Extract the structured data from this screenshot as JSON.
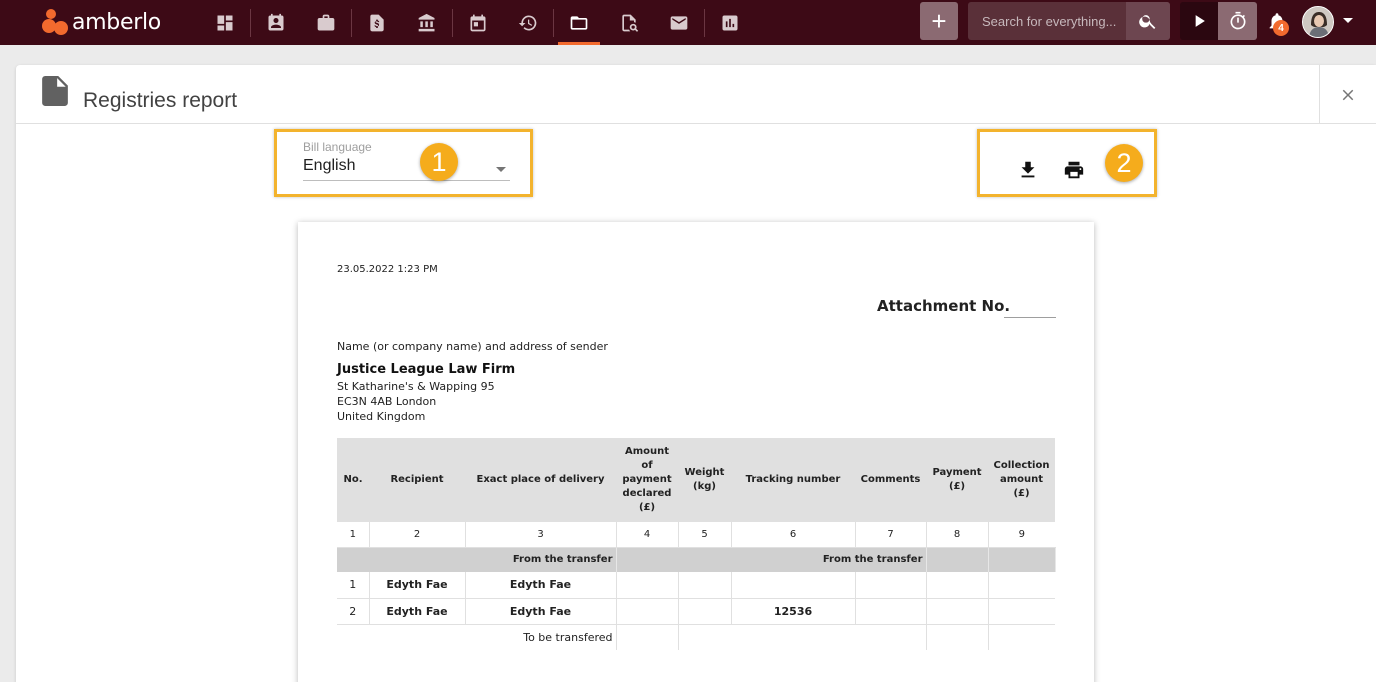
{
  "app": {
    "logo_text": "amberlo",
    "brand_color": "#3d0a16",
    "accent_color": "#f26a2e"
  },
  "nav": {
    "icons": [
      {
        "name": "dashboard-icon"
      },
      {
        "name": "contacts-icon"
      },
      {
        "name": "matters-icon"
      },
      {
        "name": "billing-icon"
      },
      {
        "name": "bank-icon"
      },
      {
        "name": "calendar-icon"
      },
      {
        "name": "time-history-icon"
      },
      {
        "name": "documents-icon",
        "active": true
      },
      {
        "name": "document-search-icon"
      },
      {
        "name": "mail-icon"
      },
      {
        "name": "reports-icon"
      }
    ],
    "add_label": "+",
    "search_placeholder": "Search for everything...",
    "notifications_count": "4"
  },
  "modal": {
    "title": "Registries report"
  },
  "controls": {
    "bill_language_label": "Bill language",
    "bill_language_value": "English",
    "callout_1": "1",
    "callout_2": "2"
  },
  "report": {
    "date": "23.05.2022 1:23 PM",
    "attachment_label": "Attachment No.",
    "sender_label": "Name (or company name) and address of sender",
    "firm_name": "Justice League Law Firm",
    "address_lines": [
      "St Katharine's & Wapping 95",
      "EC3N 4AB London",
      "United Kingdom"
    ],
    "columns": [
      "No.",
      "Recipient",
      "Exact place of delivery",
      "Amount of payment declared (£)",
      "Weight (kg)",
      "Tracking number",
      "Comments",
      "Payment (£)",
      "Collection amount (£)"
    ],
    "column_numbers": [
      "1",
      "2",
      "3",
      "4",
      "5",
      "6",
      "7",
      "8",
      "9"
    ],
    "from_transfer_label": "From the transfer",
    "rows": [
      {
        "no": "1",
        "recipient": "Edyth Fae",
        "place": "Edyth Fae",
        "amount": "",
        "weight": "",
        "tracking": "",
        "comments": "",
        "payment": "",
        "collection": ""
      },
      {
        "no": "2",
        "recipient": "Edyth Fae",
        "place": "Edyth Fae",
        "amount": "",
        "weight": "",
        "tracking": "12536",
        "comments": "",
        "payment": "",
        "collection": ""
      }
    ],
    "to_be_transferred_label": "To be transfered"
  }
}
